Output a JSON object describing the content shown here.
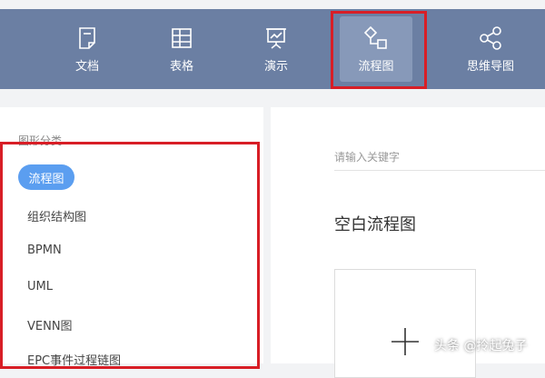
{
  "toolbar": {
    "items": [
      {
        "label": "文档",
        "icon": "document-icon"
      },
      {
        "label": "表格",
        "icon": "table-icon"
      },
      {
        "label": "演示",
        "icon": "presentation-icon"
      },
      {
        "label": "流程图",
        "icon": "flowchart-icon",
        "active": true
      },
      {
        "label": "思维导图",
        "icon": "mindmap-icon"
      }
    ]
  },
  "sidebar": {
    "title": "图形分类",
    "active_category": "流程图",
    "categories": [
      "组织结构图",
      "BPMN",
      "UML",
      "VENN图",
      "EPC事件过程链图"
    ]
  },
  "main": {
    "search_placeholder": "请输入关键字",
    "section_title": "空白流程图"
  },
  "watermark": "头条 @拎起兔子",
  "colors": {
    "topbar": "#6b7fa3",
    "active_tool": "#8799b9",
    "active_category": "#5b9ef0",
    "highlight": "#d81e26"
  }
}
